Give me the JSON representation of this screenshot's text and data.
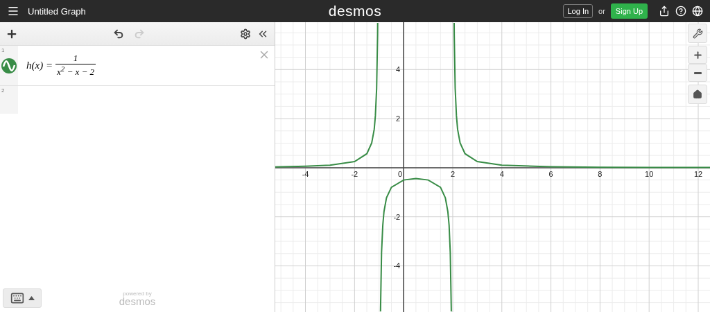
{
  "top_bar": {
    "title": "Untitled Graph",
    "logo": "desmos",
    "login": "Log In",
    "or": "or",
    "signup": "Sign Up"
  },
  "expressions": [
    {
      "number": "1",
      "lhs": "h(x) =",
      "numerator": "1",
      "denominator": "x$^{2}$ − x − 2",
      "color": "#388c46"
    },
    {
      "number": "2"
    }
  ],
  "footer": {
    "powered_by": "powered by",
    "brand": "desmos"
  },
  "graph": {
    "chart_data": {
      "type": "line",
      "xlim": [
        -5.23,
        12.48
      ],
      "ylim": [
        -5.88,
        5.93
      ],
      "xticks": [
        -4,
        -2,
        0,
        2,
        4,
        6,
        8,
        10,
        12
      ],
      "yticks": [
        -4,
        -2,
        2,
        4
      ],
      "grid": true,
      "series": [
        {
          "color": "#388c46",
          "x": [
            -5.23,
            -4,
            -3,
            -2,
            -1.5,
            -1.3,
            -1.2,
            -1.15,
            -1.1,
            -1.06,
            -1.057,
            -1,
            -0.942,
            -0.94,
            -0.9,
            -0.85,
            -0.8,
            -0.7,
            -0.5,
            0,
            0.5,
            1,
            1.5,
            1.7,
            1.8,
            1.85,
            1.9,
            1.94,
            1.942,
            2,
            2.057,
            2.06,
            2.1,
            2.15,
            2.2,
            2.3,
            2.5,
            3,
            4,
            6,
            8,
            10,
            12.48
          ],
          "values": [
            0.03,
            0.06,
            0.1,
            0.25,
            0.57,
            1.01,
            1.56,
            2.12,
            3.23,
            5.45,
            5.9,
            null,
            -5.86,
            -5.67,
            -3.45,
            -2.34,
            -1.79,
            -1.23,
            -0.8,
            -0.5,
            -0.44,
            -0.5,
            -0.8,
            -1.23,
            -1.79,
            -2.34,
            -3.45,
            -5.67,
            -5.86,
            null,
            5.9,
            5.45,
            3.23,
            2.12,
            1.56,
            1.01,
            0.57,
            0.25,
            0.1,
            0.04,
            0.02,
            0.01,
            0.01
          ]
        }
      ]
    }
  }
}
